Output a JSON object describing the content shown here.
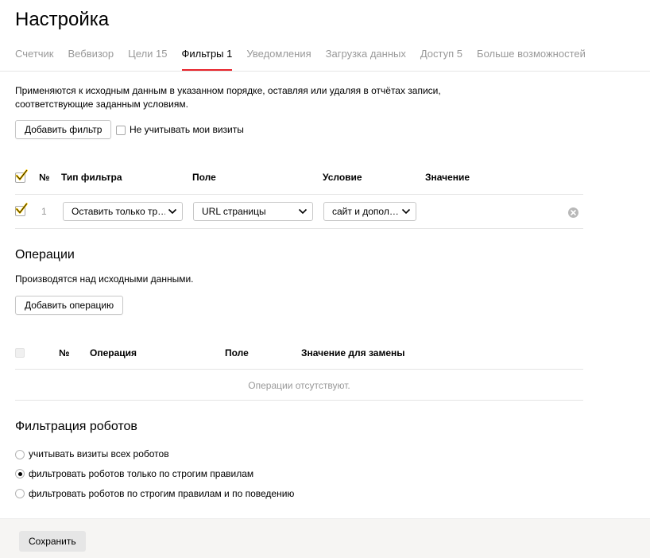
{
  "page_title": "Настройка",
  "tabs": [
    {
      "label": "Счетчик"
    },
    {
      "label": "Вебвизор"
    },
    {
      "label": "Цели 15"
    },
    {
      "label": "Фильтры 1"
    },
    {
      "label": "Уведомления"
    },
    {
      "label": "Загрузка данных"
    },
    {
      "label": "Доступ 5"
    },
    {
      "label": "Больше возможностей"
    }
  ],
  "active_tab": "Фильтры 1",
  "accent_color": "#e8232b",
  "checkbox_color": "#ffcc00",
  "filters": {
    "description": "Применяются к исходным данным в указанном порядке, оставляя или удаляя в отчётах записи, соответствующие заданным условиям.",
    "add_button": "Добавить фильтр",
    "ignore_visits_label": "Не учитывать мои визиты",
    "ignore_visits_checked": false,
    "header_checkbox_checked": true,
    "columns": {
      "num": "№",
      "type": "Тип фильтра",
      "field": "Поле",
      "condition": "Условие",
      "value": "Значение"
    },
    "rows": [
      {
        "checked": true,
        "num": "1",
        "type": "Оставить только тр…",
        "field": "URL страницы",
        "condition": "сайт и допол…",
        "value": ""
      }
    ]
  },
  "operations": {
    "title": "Операции",
    "description": "Производятся над исходными данными.",
    "add_button": "Добавить операцию",
    "columns": {
      "num": "№",
      "operation": "Операция",
      "field": "Поле",
      "replace_value": "Значение для замены"
    },
    "empty_text": "Операции отсутствуют."
  },
  "robots": {
    "title": "Фильтрация роботов",
    "options": [
      {
        "label": "учитывать визиты всех роботов",
        "checked": false
      },
      {
        "label": "фильтровать роботов только по строгим правилам",
        "checked": true
      },
      {
        "label": "фильтровать роботов по строгим правилам и по поведению",
        "checked": false
      }
    ]
  },
  "footer": {
    "save_button": "Сохранить"
  }
}
